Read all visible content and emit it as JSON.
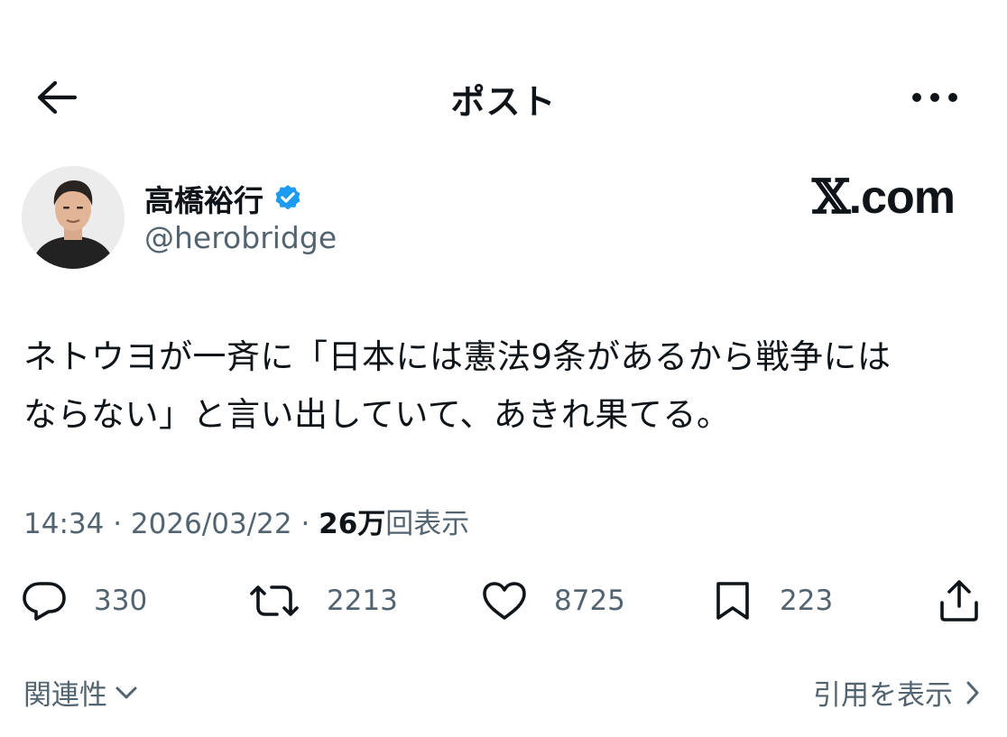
{
  "header": {
    "title": "ポスト",
    "back_icon": "arrow-left-icon",
    "more_icon": "more-horizontal-icon"
  },
  "author": {
    "display_name": "高橋裕行",
    "handle": "@herobridge",
    "verified": true,
    "verified_color": "#1d9bf0"
  },
  "brand": {
    "x_glyph": "𝕏",
    "suffix": ".com"
  },
  "tweet": {
    "lines": [
      "ネトウヨが一斉に「日本には憲法9条があるから戦争には",
      "ならない」と言い出していて、あきれ果てる。"
    ]
  },
  "meta": {
    "time": "14:34",
    "sep1": " · ",
    "date": "2026/03/22",
    "sep2": " · ",
    "views_count": "26万",
    "views_label": "回表示"
  },
  "actions": {
    "reply": {
      "icon": "reply-icon",
      "count": "330"
    },
    "repost": {
      "icon": "repost-icon",
      "count": "2213"
    },
    "like": {
      "icon": "heart-icon",
      "count": "8725"
    },
    "bookmark": {
      "icon": "bookmark-icon",
      "count": "223"
    },
    "share": {
      "icon": "share-icon"
    }
  },
  "footer": {
    "relevance_label": "関連性",
    "quotes_label": "引用を表示"
  },
  "colors": {
    "text_primary": "#0f1419",
    "text_secondary": "#536471",
    "accent": "#1d9bf0",
    "background": "#ffffff"
  }
}
